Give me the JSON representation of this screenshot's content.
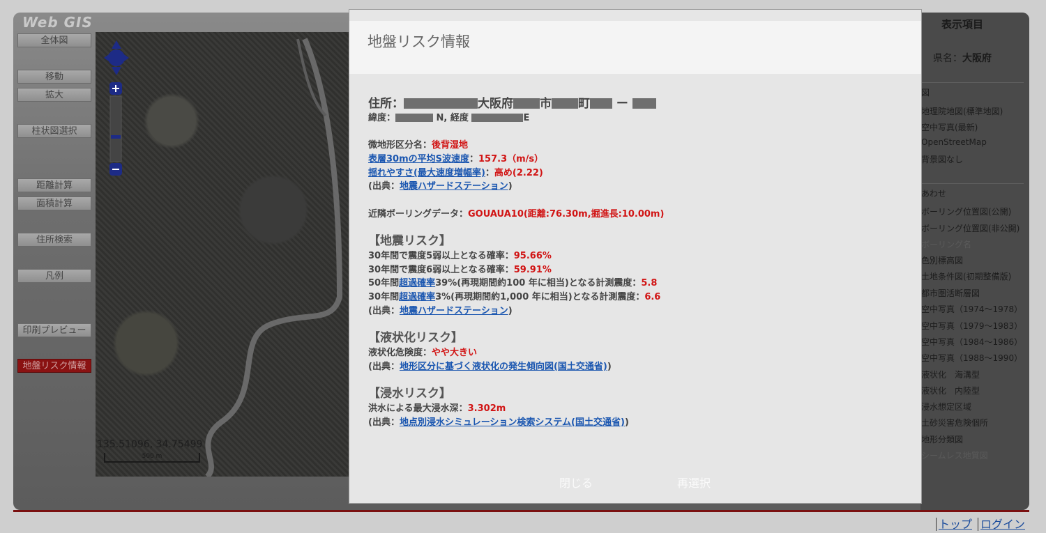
{
  "app": {
    "brand": "Web GIS",
    "tools": [
      {
        "label": "全体図"
      },
      {
        "label": "移動"
      },
      {
        "label": "拡大"
      },
      {
        "label": "柱状図選択"
      },
      {
        "label": "距離計算"
      },
      {
        "label": "面積計算"
      },
      {
        "label": "住所検索"
      },
      {
        "label": "凡例"
      },
      {
        "label": "印刷プレビュー"
      },
      {
        "label": "地盤リスク情報",
        "active": true
      }
    ],
    "map": {
      "coords": "135.51096, 34.75499",
      "scale_label": "500 m"
    }
  },
  "right_panel": {
    "title": "表示項目",
    "prefecture_label": "県名：",
    "prefecture_value": "大阪府",
    "group_base_label": "図",
    "base_items": [
      "地理院地図(標準地図)",
      "空中写真(最新)",
      "OpenStreetMap",
      "背景図なし"
    ],
    "group_overlay_label": "あわせ",
    "overlay_items": [
      {
        "label": "ボーリング位置図(公開)",
        "dim": false
      },
      {
        "label": "ボーリング位置図(非公開)",
        "dim": false
      },
      {
        "label": "ボーリング名",
        "dim": true
      },
      {
        "label": "色別標高図",
        "dim": false
      },
      {
        "label": "土地条件図(初期整備版)",
        "dim": false
      },
      {
        "label": "都市圏活断層図",
        "dim": false
      },
      {
        "label": "空中写真（1974～1978）",
        "dim": false
      },
      {
        "label": "空中写真（1979～1983）",
        "dim": false
      },
      {
        "label": "空中写真（1984～1986）",
        "dim": false
      },
      {
        "label": "空中写真（1988～1990）",
        "dim": false
      },
      {
        "label": "液状化　海溝型",
        "dim": false
      },
      {
        "label": "液状化　内陸型",
        "dim": false
      },
      {
        "label": "浸水想定区域",
        "dim": false
      },
      {
        "label": "土砂災害危険個所",
        "dim": false
      },
      {
        "label": "地形分類図",
        "dim": false
      },
      {
        "label": "シームレス地質図",
        "dim": true
      }
    ]
  },
  "footer": {
    "top_link": "トップ",
    "login_link": "ログイン"
  },
  "modal": {
    "title": "地盤リスク情報",
    "address_label": "住所：",
    "address_parts": [
      "大阪府",
      "市",
      "町",
      "ー"
    ],
    "latlon_label": "緯度：",
    "lat_suffix": "N, 経度",
    "lon_suffix": "E",
    "landform_label": "微地形区分名：",
    "landform_value": "後背湿地",
    "vs30_link": "表層30mの平均S波速度",
    "vs30_value": "157.3（m/s）",
    "shake_link": "揺れやすさ(最大速度増幅率)",
    "shake_value": "高め(2.22)",
    "source_open": "(出典：",
    "source_close": ")",
    "source1_link": "地震ハザードステーション",
    "boring_label": "近隣ボーリングデータ：",
    "boring_value": "GOUAUA10(距離:76.30m,掘進長:10.00m)",
    "quake_heading": "【地震リスク】",
    "p5_label": "30年間で震度5弱以上となる確率：",
    "p5_value": "95.66%",
    "p6_label": "30年間で震度6弱以上となる確率：",
    "p6_value": "59.91%",
    "i50_pre": "50年間",
    "i50_link": "超過確率",
    "i50_post": "39%(再現期間約100 年に相当)となる計測震度：",
    "i50_value": "5.8",
    "i30_pre": "30年間",
    "i30_link": "超過確率",
    "i30_post": "3%(再現期間約1,000 年に相当)となる計測震度：",
    "i30_value": "6.6",
    "source2_link": "地震ハザードステーション",
    "liq_heading": "【液状化リスク】",
    "liq_label": "液状化危険度：",
    "liq_value": "やや大きい",
    "source3_link": "地形区分に基づく液状化の発生傾向図(国土交通省)",
    "flood_heading": "【浸水リスク】",
    "flood_label": "洪水による最大浸水深：",
    "flood_value": "3.302m",
    "source4_link": "地点別浸水シミュレーション検索システム(国土交通省)",
    "close_button": "閉じる",
    "reselect_button": "再選択"
  },
  "colors": {
    "accent_red": "#d11414",
    "link_blue": "#1a56b0",
    "active_tool": "#8a1212"
  }
}
